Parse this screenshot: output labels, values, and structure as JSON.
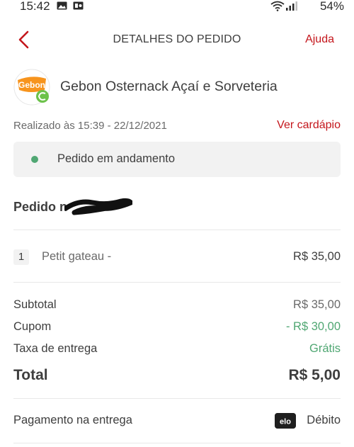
{
  "status_bar": {
    "time": "15:42",
    "battery": "54%"
  },
  "header": {
    "title": "DETALHES DO PEDIDO",
    "help_label": "Ajuda"
  },
  "restaurant": {
    "name": "Gebon Osternack Açaí e Sorveteria",
    "logo_text": "Gebon"
  },
  "order": {
    "placed_at": "Realizado às 15:39 - 22/12/2021",
    "menu_link": "Ver cardápio",
    "status": "Pedido em andamento",
    "status_color": "#50a773",
    "number_label": "Pedido n"
  },
  "items": [
    {
      "qty": "1",
      "name": "Petit gateau -",
      "price": "R$ 35,00"
    }
  ],
  "summary": {
    "subtotal_label": "Subtotal",
    "subtotal_value": "R$ 35,00",
    "coupon_label": "Cupom",
    "coupon_value": "- R$ 30,00",
    "delivery_label": "Taxa de entrega",
    "delivery_value": "Grátis",
    "total_label": "Total",
    "total_value": "R$ 5,00"
  },
  "payment": {
    "label": "Pagamento na entrega",
    "brand": "elo",
    "method": "Débito"
  },
  "colors": {
    "accent": "#c4161c",
    "positive": "#50a773",
    "logo_orange": "#f7941d"
  }
}
